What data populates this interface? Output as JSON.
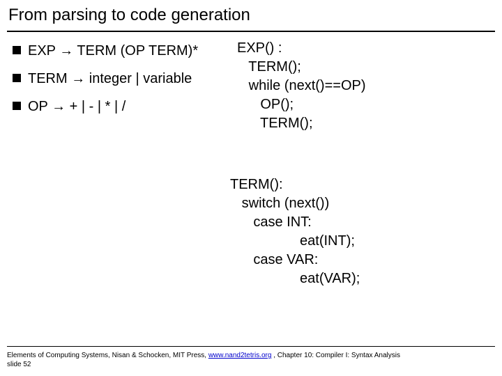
{
  "title": "From parsing to code generation",
  "grammar": {
    "items": [
      "EXP → TERM (OP TERM)*",
      "TERM → integer | variable",
      "OP → + | - | * | /"
    ]
  },
  "code_exp": "EXP() :\n   TERM();\n   while (next()==OP)\n      OP();\n      TERM();",
  "code_term": "TERM():\n   switch (next())\n      case INT:\n                  eat(INT);\n      case VAR:\n                  eat(VAR);",
  "footer": {
    "prefix": "Elements of Computing Systems, Nisan & Schocken, MIT Press, ",
    "link": "www.nand2tetris.org",
    "suffix": " , Chapter 10: Compiler I: Syntax Analysis",
    "slide": "slide 52"
  }
}
